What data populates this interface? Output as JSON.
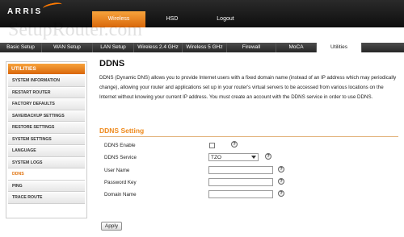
{
  "brand": {
    "logo": "ARRIS",
    "watermark": "SetupRouter.com",
    "accent": "#e0730f"
  },
  "topnav": [
    {
      "label": "Wireless",
      "active": true
    },
    {
      "label": "HSD",
      "active": false
    },
    {
      "label": "Logout",
      "active": false
    }
  ],
  "subnav": [
    {
      "label": "Basic Setup"
    },
    {
      "label": "WAN Setup"
    },
    {
      "label": "LAN Setup"
    },
    {
      "label": "Wireless 2.4 GHz"
    },
    {
      "label": "Wireless 5 GHz"
    },
    {
      "label": "Firewall"
    },
    {
      "label": "MoCA"
    },
    {
      "label": "Utilities",
      "active": true
    }
  ],
  "sidebar": {
    "header": "UTILITIES",
    "items": [
      {
        "label": "SYSTEM INFORMATION"
      },
      {
        "label": "RESTART ROUTER"
      },
      {
        "label": "FACTORY DEFAULTS"
      },
      {
        "label": "SAVE/BACKUP SETTINGS"
      },
      {
        "label": "RESTORE SETTINGS"
      },
      {
        "label": "SYSTEM SETTINGS"
      },
      {
        "label": "LANGUAGE"
      },
      {
        "label": "SYSTEM LOGS"
      },
      {
        "label": "DDNS",
        "active": true
      },
      {
        "label": "PING"
      },
      {
        "label": "TRACE ROUTE"
      }
    ]
  },
  "main": {
    "title": "DDNS",
    "intro": "DDNS (Dynamic DNS) allows you to provide Internet users with a fixed domain name (instead of an IP address which may periodically change), allowing your router and applications set up in your router's virtual servers to be accessed from various locations on the Internet without knowing your current IP address. You must create an account with the DDNS service in order to use DDNS.",
    "section_title": "DDNS Setting",
    "fields": {
      "enable_label": "DDNS Enable",
      "enable_checked": false,
      "service_label": "DDNS Service",
      "service_value": "TZO",
      "username_label": "User Name",
      "username_value": "",
      "password_label": "Password Key",
      "password_value": "",
      "domain_label": "Domain Name",
      "domain_value": ""
    },
    "help_glyph": "?",
    "apply_label": "Apply"
  }
}
